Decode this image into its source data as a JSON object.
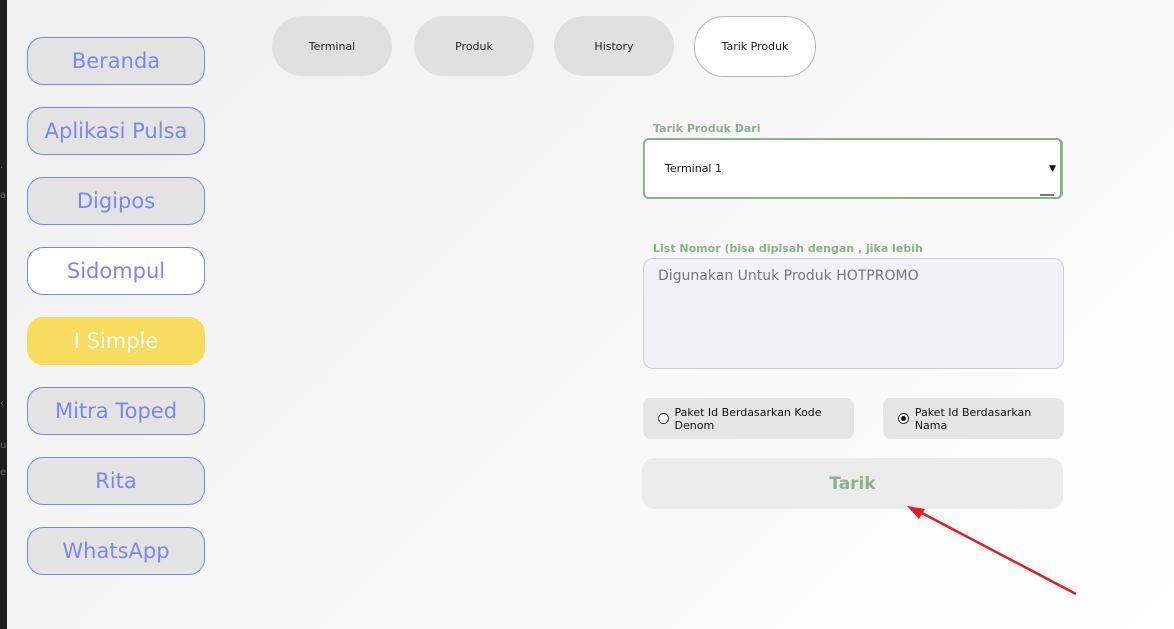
{
  "sidebar": {
    "items": [
      {
        "label": "Beranda"
      },
      {
        "label": "Aplikasi Pulsa"
      },
      {
        "label": "Digipos"
      },
      {
        "label": "Sidompul"
      },
      {
        "label": "I Simple"
      },
      {
        "label": "Mitra Toped"
      },
      {
        "label": "Rita"
      },
      {
        "label": "WhatsApp"
      }
    ],
    "active": "I Simple"
  },
  "tabs": [
    {
      "label": "Terminal"
    },
    {
      "label": "Produk"
    },
    {
      "label": "History"
    },
    {
      "label": "Tarik Produk"
    }
  ],
  "active_tab": "Tarik Produk",
  "form": {
    "source_label": "Tarik Produk Dari",
    "source_value": "Terminal 1",
    "list_label": "List Nomor (bisa dipisah dengan , jika lebih",
    "list_value": "Digunakan Untuk Produk HOTPROMO",
    "radio_options": [
      {
        "label": "Paket Id Berdasarkan Kode Denom",
        "checked": false
      },
      {
        "label": "Paket Id Berdasarkan Nama",
        "checked": true
      }
    ],
    "submit_label": "Tarik"
  },
  "colors": {
    "accent": "#7b86f0",
    "active": "#f7dc60",
    "label_green": "#8ab28c",
    "annotation_arrow": "#e02020"
  }
}
